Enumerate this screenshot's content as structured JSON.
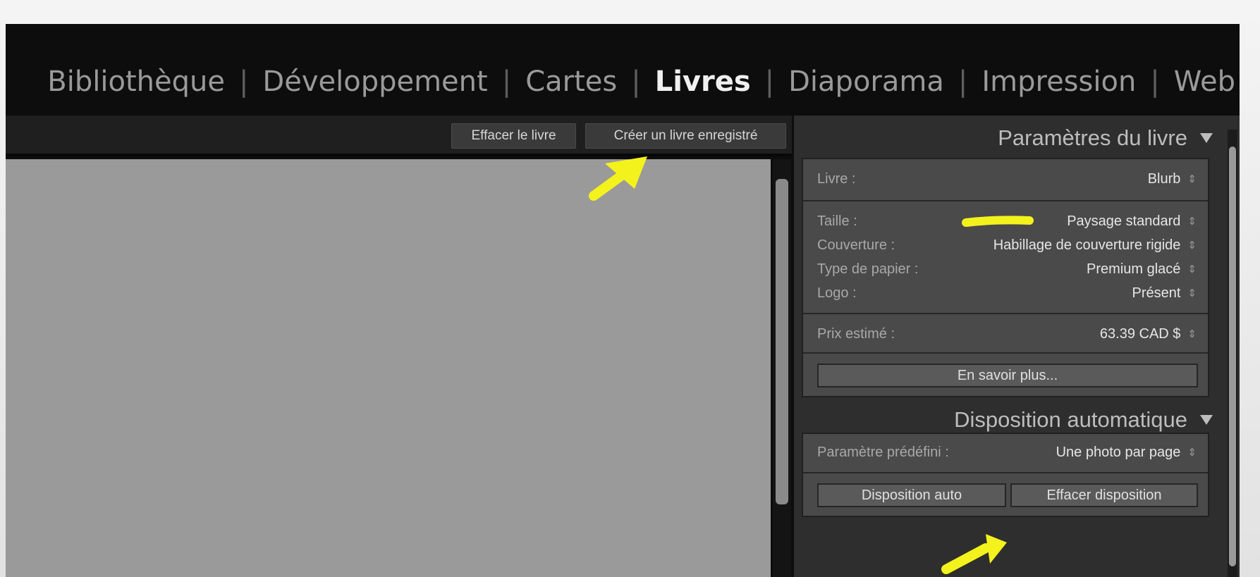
{
  "modules": [
    {
      "label": "Bibliothèque"
    },
    {
      "label": "Développement"
    },
    {
      "label": "Cartes"
    },
    {
      "label": "Livres"
    },
    {
      "label": "Diaporama"
    },
    {
      "label": "Impression"
    },
    {
      "label": "Web"
    }
  ],
  "active_module": "Livres",
  "toolbar": {
    "clear_book_label": "Effacer le livre",
    "save_book_label": "Créer un livre enregistré"
  },
  "book_settings": {
    "header": "Paramètres du livre",
    "book_label": "Livre :",
    "book_value": "Blurb",
    "size_label": "Taille :",
    "size_value": "Paysage standard",
    "cover_label": "Couverture :",
    "cover_value": "Habillage de couverture rigide",
    "paper_label": "Type de papier :",
    "paper_value": "Premium glacé",
    "logo_label": "Logo :",
    "logo_value": "Présent",
    "price_label": "Prix estimé :",
    "price_value": "63.39 CAD $",
    "learn_more_label": "En savoir plus..."
  },
  "auto_layout": {
    "header": "Disposition automatique",
    "preset_label": "Paramètre prédéfini :",
    "preset_value": "Une photo par page",
    "auto_layout_button": "Disposition auto",
    "clear_layout_button": "Effacer disposition"
  },
  "colors": {
    "app_background": "#0d0d0d",
    "canvas": "#9a9a9a",
    "panel": "#2e2e2e",
    "annotation_highlight": "#f4f21c"
  },
  "icons": {
    "collapse": "triangle-down-icon",
    "stepper": "up-down-arrows-icon"
  }
}
